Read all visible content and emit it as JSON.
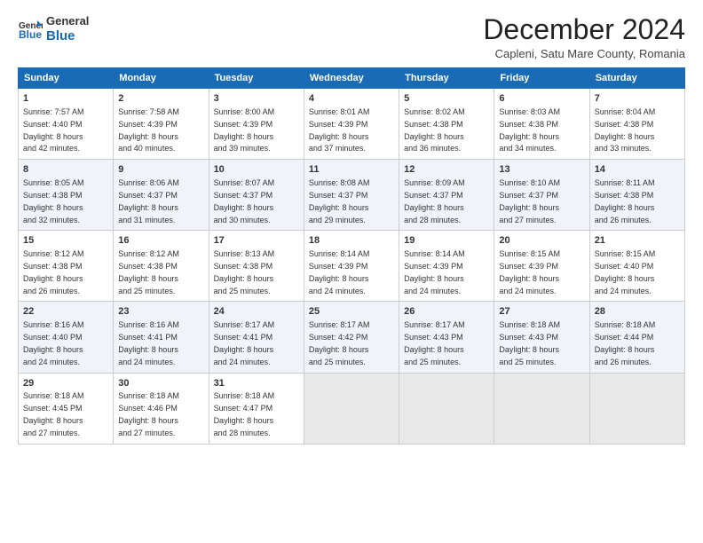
{
  "logo": {
    "general": "General",
    "blue": "Blue",
    "icon_color": "#1a6bb5"
  },
  "title": "December 2024",
  "subtitle": "Capleni, Satu Mare County, Romania",
  "columns": [
    "Sunday",
    "Monday",
    "Tuesday",
    "Wednesday",
    "Thursday",
    "Friday",
    "Saturday"
  ],
  "weeks": [
    [
      {
        "day": "1",
        "detail": "Sunrise: 7:57 AM\nSunset: 4:40 PM\nDaylight: 8 hours\nand 42 minutes."
      },
      {
        "day": "2",
        "detail": "Sunrise: 7:58 AM\nSunset: 4:39 PM\nDaylight: 8 hours\nand 40 minutes."
      },
      {
        "day": "3",
        "detail": "Sunrise: 8:00 AM\nSunset: 4:39 PM\nDaylight: 8 hours\nand 39 minutes."
      },
      {
        "day": "4",
        "detail": "Sunrise: 8:01 AM\nSunset: 4:39 PM\nDaylight: 8 hours\nand 37 minutes."
      },
      {
        "day": "5",
        "detail": "Sunrise: 8:02 AM\nSunset: 4:38 PM\nDaylight: 8 hours\nand 36 minutes."
      },
      {
        "day": "6",
        "detail": "Sunrise: 8:03 AM\nSunset: 4:38 PM\nDaylight: 8 hours\nand 34 minutes."
      },
      {
        "day": "7",
        "detail": "Sunrise: 8:04 AM\nSunset: 4:38 PM\nDaylight: 8 hours\nand 33 minutes."
      }
    ],
    [
      {
        "day": "8",
        "detail": "Sunrise: 8:05 AM\nSunset: 4:38 PM\nDaylight: 8 hours\nand 32 minutes."
      },
      {
        "day": "9",
        "detail": "Sunrise: 8:06 AM\nSunset: 4:37 PM\nDaylight: 8 hours\nand 31 minutes."
      },
      {
        "day": "10",
        "detail": "Sunrise: 8:07 AM\nSunset: 4:37 PM\nDaylight: 8 hours\nand 30 minutes."
      },
      {
        "day": "11",
        "detail": "Sunrise: 8:08 AM\nSunset: 4:37 PM\nDaylight: 8 hours\nand 29 minutes."
      },
      {
        "day": "12",
        "detail": "Sunrise: 8:09 AM\nSunset: 4:37 PM\nDaylight: 8 hours\nand 28 minutes."
      },
      {
        "day": "13",
        "detail": "Sunrise: 8:10 AM\nSunset: 4:37 PM\nDaylight: 8 hours\nand 27 minutes."
      },
      {
        "day": "14",
        "detail": "Sunrise: 8:11 AM\nSunset: 4:38 PM\nDaylight: 8 hours\nand 26 minutes."
      }
    ],
    [
      {
        "day": "15",
        "detail": "Sunrise: 8:12 AM\nSunset: 4:38 PM\nDaylight: 8 hours\nand 26 minutes."
      },
      {
        "day": "16",
        "detail": "Sunrise: 8:12 AM\nSunset: 4:38 PM\nDaylight: 8 hours\nand 25 minutes."
      },
      {
        "day": "17",
        "detail": "Sunrise: 8:13 AM\nSunset: 4:38 PM\nDaylight: 8 hours\nand 25 minutes."
      },
      {
        "day": "18",
        "detail": "Sunrise: 8:14 AM\nSunset: 4:39 PM\nDaylight: 8 hours\nand 24 minutes."
      },
      {
        "day": "19",
        "detail": "Sunrise: 8:14 AM\nSunset: 4:39 PM\nDaylight: 8 hours\nand 24 minutes."
      },
      {
        "day": "20",
        "detail": "Sunrise: 8:15 AM\nSunset: 4:39 PM\nDaylight: 8 hours\nand 24 minutes."
      },
      {
        "day": "21",
        "detail": "Sunrise: 8:15 AM\nSunset: 4:40 PM\nDaylight: 8 hours\nand 24 minutes."
      }
    ],
    [
      {
        "day": "22",
        "detail": "Sunrise: 8:16 AM\nSunset: 4:40 PM\nDaylight: 8 hours\nand 24 minutes."
      },
      {
        "day": "23",
        "detail": "Sunrise: 8:16 AM\nSunset: 4:41 PM\nDaylight: 8 hours\nand 24 minutes."
      },
      {
        "day": "24",
        "detail": "Sunrise: 8:17 AM\nSunset: 4:41 PM\nDaylight: 8 hours\nand 24 minutes."
      },
      {
        "day": "25",
        "detail": "Sunrise: 8:17 AM\nSunset: 4:42 PM\nDaylight: 8 hours\nand 25 minutes."
      },
      {
        "day": "26",
        "detail": "Sunrise: 8:17 AM\nSunset: 4:43 PM\nDaylight: 8 hours\nand 25 minutes."
      },
      {
        "day": "27",
        "detail": "Sunrise: 8:18 AM\nSunset: 4:43 PM\nDaylight: 8 hours\nand 25 minutes."
      },
      {
        "day": "28",
        "detail": "Sunrise: 8:18 AM\nSunset: 4:44 PM\nDaylight: 8 hours\nand 26 minutes."
      }
    ],
    [
      {
        "day": "29",
        "detail": "Sunrise: 8:18 AM\nSunset: 4:45 PM\nDaylight: 8 hours\nand 27 minutes."
      },
      {
        "day": "30",
        "detail": "Sunrise: 8:18 AM\nSunset: 4:46 PM\nDaylight: 8 hours\nand 27 minutes."
      },
      {
        "day": "31",
        "detail": "Sunrise: 8:18 AM\nSunset: 4:47 PM\nDaylight: 8 hours\nand 28 minutes."
      },
      {
        "day": "",
        "detail": ""
      },
      {
        "day": "",
        "detail": ""
      },
      {
        "day": "",
        "detail": ""
      },
      {
        "day": "",
        "detail": ""
      }
    ]
  ]
}
